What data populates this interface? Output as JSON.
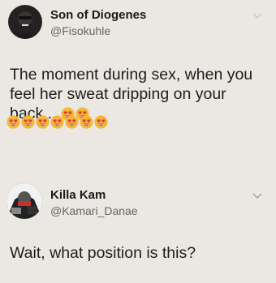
{
  "tweet1": {
    "name": "Son of Diogenes",
    "handle": "@Fisokuhle",
    "text": "The moment during sex, when you feel her sweat dripping on your back...",
    "emoji": "heart-eyes-emoji",
    "inline_emoji_count": 2,
    "row_emoji_count": 7
  },
  "tweet2": {
    "name": "Killa Kam",
    "handle": "@Kamari_Danae",
    "text": "Wait, what position is this?"
  },
  "colors": {
    "background": "#ebe8e3",
    "emoji_face": "#f4b63a",
    "emoji_heart": "#e23b3b"
  }
}
